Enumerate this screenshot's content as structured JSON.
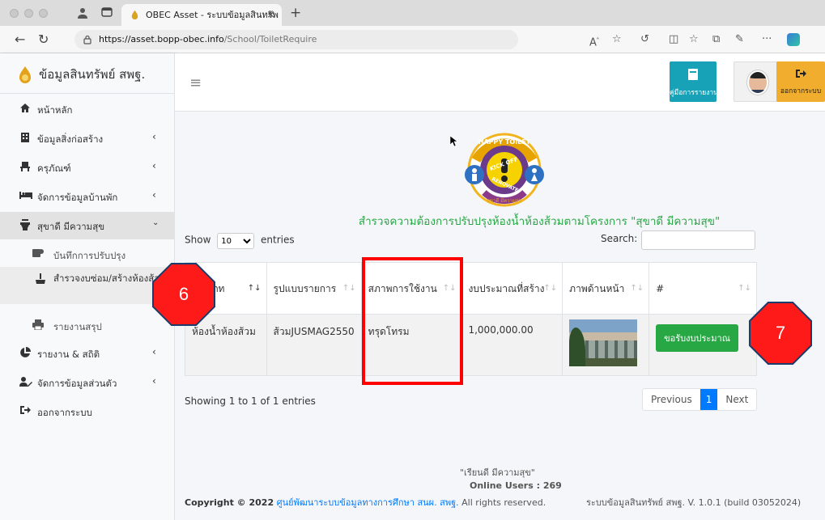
{
  "browser": {
    "tab_title": "OBEC Asset - ระบบข้อมูลสินทรัพ",
    "url_host": "https://asset.bopp-obec.info",
    "url_path": "/School/ToiletRequire"
  },
  "sidebar": {
    "brand": "ข้อมูลสินทรัพย์ สพฐ.",
    "items": [
      {
        "label": "หน้าหลัก",
        "icon": "home-icon"
      },
      {
        "label": "ข้อมูลสิ่งก่อสร้าง",
        "icon": "building-icon"
      },
      {
        "label": "ครุภัณฑ์",
        "icon": "chair-icon"
      },
      {
        "label": "จัดการข้อมูลบ้านพัก",
        "icon": "bed-icon"
      },
      {
        "label": "สุขาดี มีความสุข",
        "icon": "toilet-icon"
      },
      {
        "label": "บันทึกการปรับปรุง",
        "icon": "toilet-paper-icon"
      },
      {
        "label": "สำรวจงบซ่อม/สร้างห้องส้วม",
        "icon": "broom-icon"
      },
      {
        "label": "รายงานสรุป",
        "icon": "print-icon"
      },
      {
        "label": "รายงาน & สถิติ",
        "icon": "chart-pie-icon"
      },
      {
        "label": "จัดการข้อมูลส่วนตัว",
        "icon": "user-edit-icon"
      },
      {
        "label": "ออกจากระบบ",
        "icon": "sign-out-icon"
      }
    ]
  },
  "header": {
    "manual_label": "คู่มือการรายงาน",
    "logout_label": "ออกจากระบบ"
  },
  "logo_text": {
    "top": "HAPPY TOILET",
    "middle": "KICK OFF",
    "bottom": "RENOVATE",
    "ring": "สุขาดี มีความสุข"
  },
  "page": {
    "title": "สำรวจความต้องการปรับปรุงห้องน้ำห้องส้วมตามโครงการ \"สุขาดี มีความสุข\"",
    "show_label": "Show",
    "entries_label": "entries",
    "page_size": "10",
    "search_label": "Search:"
  },
  "table": {
    "columns": [
      "ประเภท",
      "รูปแบบรายการ",
      "สภาพการใช้งาน",
      "งบประมาณที่สร้าง",
      "ภาพด้านหน้า",
      "#"
    ],
    "rows": [
      {
        "type": "ห้องน้ำห้องส้วม",
        "model": "ส้วมJUSMAG2550",
        "condition": "ทรุดโทรม",
        "budget": "1,000,000.00",
        "action_label": "ขอรับงบประมาณ"
      }
    ]
  },
  "pagination": {
    "info": "Showing 1 to 1 of 1 entries",
    "previous": "Previous",
    "current": "1",
    "next": "Next"
  },
  "footer": {
    "slogan": "\"เรียนดี มีความสุข\"",
    "online": "Online Users : 269",
    "copy_prefix": "Copyright © 2022",
    "copy_link": "ศูนย์พัฒนาระบบข้อมูลทางการศึกษา สนผ. สพฐ.",
    "copy_suffix": "All rights reserved.",
    "version": "ระบบข้อมูลสินทรัพย์ สพฐ. V. 1.0.1 (build 03052024)"
  },
  "annotations": {
    "badge_6": "6",
    "badge_7": "7",
    "highlight_color": "#ff0000"
  },
  "colors": {
    "accent_green": "#28a745",
    "info_teal": "#17a2b8",
    "warning_orange": "#f0ad2e",
    "primary_blue": "#007bff"
  }
}
